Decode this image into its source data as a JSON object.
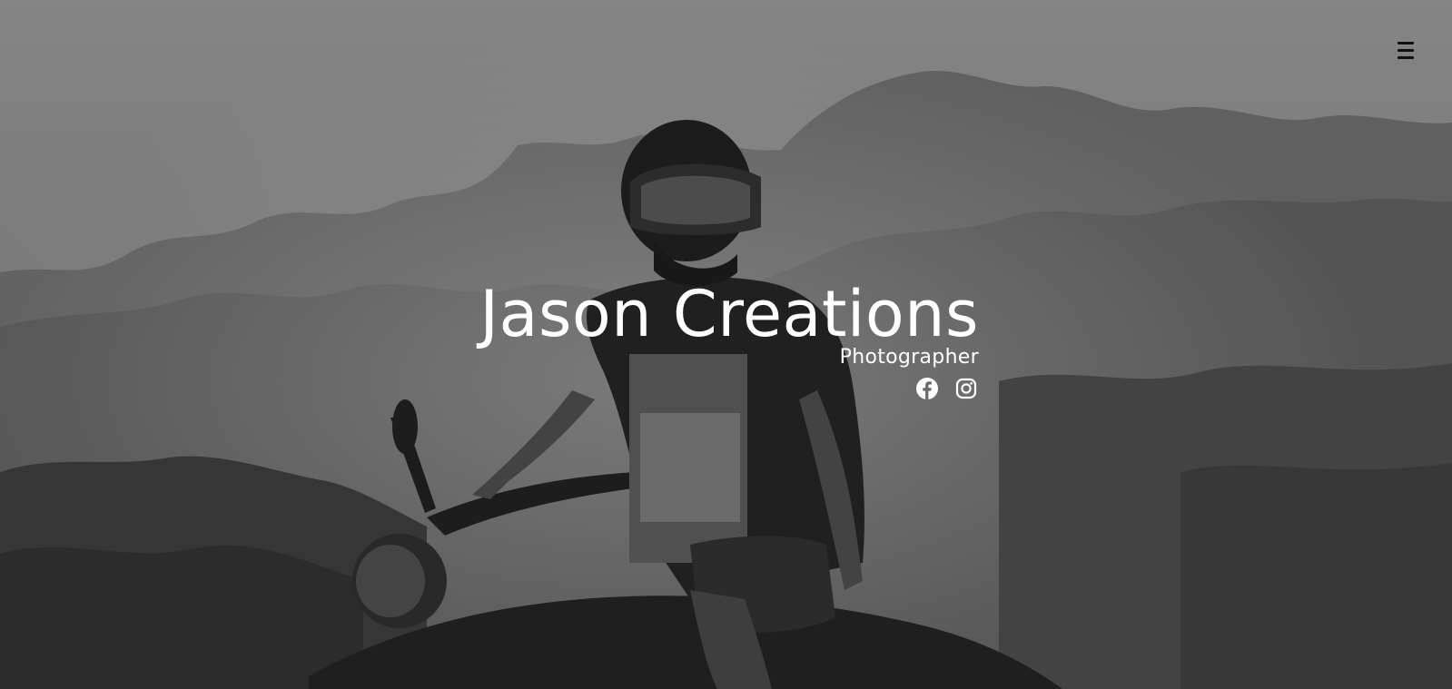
{
  "header": {
    "menu_icon": "hamburger-menu-icon",
    "menu_label": "Menu"
  },
  "hero": {
    "title": "Jason Creations",
    "subtitle": "Photographer",
    "background": {
      "description_icon": "monochrome-motorcycle-rider-photo",
      "tone": "#6f6f6f"
    }
  },
  "social": [
    {
      "icon": "facebook-icon",
      "label": "Facebook"
    },
    {
      "icon": "instagram-icon",
      "label": "Instagram"
    }
  ],
  "colors": {
    "text": "#ffffff",
    "menu": "#111111"
  }
}
